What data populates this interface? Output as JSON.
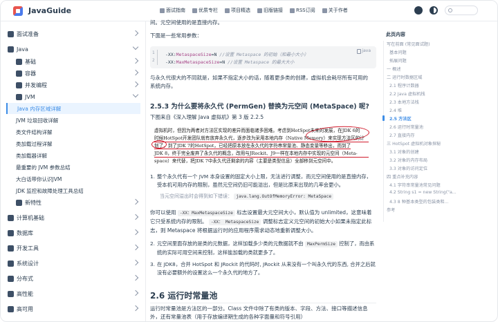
{
  "navbar": {
    "brand": "JavaGuide",
    "links": [
      "面试指南",
      "优质专栏",
      "项目精选",
      "旧版链接",
      "RSS订阅",
      "关于作者"
    ]
  },
  "sidebar": {
    "items": [
      {
        "label": "面试准备",
        "level": 1,
        "expanded": false
      },
      {
        "label": "Java",
        "level": 1,
        "expanded": true
      },
      {
        "label": "基础",
        "level": 2
      },
      {
        "label": "容器",
        "level": 2
      },
      {
        "label": "并发编程",
        "level": 2
      },
      {
        "label": "JVM",
        "level": 2,
        "expanded": true
      },
      {
        "label": "Java 内存区域详解",
        "level": 3,
        "active": true
      },
      {
        "label": "JVM 垃圾回收详解",
        "level": 3
      },
      {
        "label": "类文件结构详解",
        "level": 3
      },
      {
        "label": "类加载过程详解",
        "level": 3
      },
      {
        "label": "类加载器详解",
        "level": 3
      },
      {
        "label": "最重要的 JVM 参数总结",
        "level": 3
      },
      {
        "label": "大白话带你认识JVM",
        "level": 3
      },
      {
        "label": "JDK 监控和故障处理工具总结",
        "level": 3
      },
      {
        "label": "新特性",
        "level": 2
      },
      {
        "label": "计算机基础",
        "level": 1
      },
      {
        "label": "数据库",
        "level": 1
      },
      {
        "label": "开发工具",
        "level": 1
      },
      {
        "label": "系统设计",
        "level": 1
      },
      {
        "label": "分布式",
        "level": 1
      },
      {
        "label": "高性能",
        "level": 1
      },
      {
        "label": "高可用",
        "level": 1
      }
    ]
  },
  "content": {
    "intro1": "间。元空间使用的是直接内存。",
    "intro2": "下面是一些常用参数：",
    "code": {
      "lang": "java",
      "lines": [
        {
          "n": "1",
          "pre": "-XX:",
          "key": "MetaspaceSize",
          "val": "=N",
          "comment": "//设置 Metaspace 的初始（和最小大小）"
        },
        {
          "n": "2",
          "pre": "-XX:",
          "key": "MaxMetaspaceSize",
          "val": "=N",
          "comment": "//设置 Metaspace 的最大大小"
        }
      ]
    },
    "para_after_code": "与永久代很大的不同就是，如果不指定大小的话，随着更多类的创建，虚拟机会耗尽所有可用的系统内存。",
    "h3": "2.5.3 为什么要将永久代 (PermGen) 替换为元空间 (MetaSpace) 呢?",
    "source": "下图来自《深入理解 Java 虚拟机》第 3 版 2.2.5",
    "book_text": [
      "虚拟机时，但因为两者对方法区实现的差异而面临诸多困难。考虑到HotSpot未来的发展，在JDK 6的",
      "时候HotSpot开发团队就有放弃永久代，逐步改为采用本地内存（Native Memory）来实现方法区的计",
      "划了",
      "，到了JDK 7的HotSpot，已经把原本放在永久代的字符串常量池、静态变量等移出，而到了",
      "JDK 8，终于完全废弃了永久代的概念，改用与JRockit、J9一样在本地内存中实现的元空间（Meta-",
      "space）来代替，把JDK 7中永久代还剩余的内容（主要是类型信息）全部移到元空间中。"
    ],
    "item1": "整个永久代有一个 JVM 本身设置的固定大小上限，无法进行调整，而元空间使用的是直接内存，受本机可用内存的限制，虽然元空间仍旧可能溢出，但是比原来出现的几率会更小。",
    "quote_prefix": "当元空间溢出时会得到如下错误：",
    "quote_code": "java.lang.OutOfMemoryError: MetaSpace",
    "para_mid_1": "你可以使用",
    "para_mid_code1": "-XX：MaxMetaspaceSize",
    "para_mid_2": "标志设置最大元空间大小，默认值为 unlimited，这意味着它只受系统内存的限制。",
    "para_mid_code2": "-XX： MetaspaceSize",
    "para_mid_3": "调整标志定义元空间的初始大小如果未指定此标志，则 Metaspace 将根据运行时的应用程序需求动态地重新调整大小。",
    "item2_a": "元空间里面存放的是类的元数据，这样加载多少类的元数据就不由",
    "item2_code": "MaxPermSize",
    "item2_b": "控制了，而由系统的实际可用空间来控制，这样能加载的类就更多了。",
    "item3": "在 JDK8，合并 HotSpot 和 JRockit 的代码时, JRockit 从来没有一个叫永久代的东西, 合并之后就没有必要额外的设置这么一个永久代的地方了。",
    "h2": "2.6 运行时常量池",
    "para_last": "运行时常量池是方法区的一部分。Class 文件中除了有类的版本、字段、方法、接口等描述信息外，还有常量池表（用于存放编译期生成的各种字面量和符号引用）"
  },
  "toc": {
    "title": "此页内容",
    "items": [
      {
        "label": "写在前面 (常见面试题)",
        "level": 1
      },
      {
        "label": "基本问题",
        "level": 2
      },
      {
        "label": "拓展问题",
        "level": 2
      },
      {
        "label": "一 概述",
        "level": 1
      },
      {
        "label": "二 运行时数据区域",
        "level": 1
      },
      {
        "label": "2.1 程序计数器",
        "level": 2
      },
      {
        "label": "2.2 Java 虚拟机栈",
        "level": 2
      },
      {
        "label": "2.3 本地方法栈",
        "level": 2
      },
      {
        "label": "2.4 堆",
        "level": 2
      },
      {
        "label": "2.5 方法区",
        "level": 2,
        "active": true
      },
      {
        "label": "2.6 运行时常量池",
        "level": 2
      },
      {
        "label": "2.7 直接内存",
        "level": 2
      },
      {
        "label": "三 HotSpot 虚拟机对象探秘",
        "level": 1
      },
      {
        "label": "3.1 对象的创建",
        "level": 2
      },
      {
        "label": "3.2 对象的内存布局",
        "level": 2
      },
      {
        "label": "3.3 对象的访问定位",
        "level": 2
      },
      {
        "label": "四 重点补充内容",
        "level": 1
      },
      {
        "label": "4.1 字符串常量池常见问题",
        "level": 2
      },
      {
        "label": "4.2 String s1 = new String(\"a...",
        "level": 2
      },
      {
        "label": "4.3 8 种基本类型的包装类和...",
        "level": 2
      },
      {
        "label": "参考",
        "level": 1
      }
    ]
  }
}
